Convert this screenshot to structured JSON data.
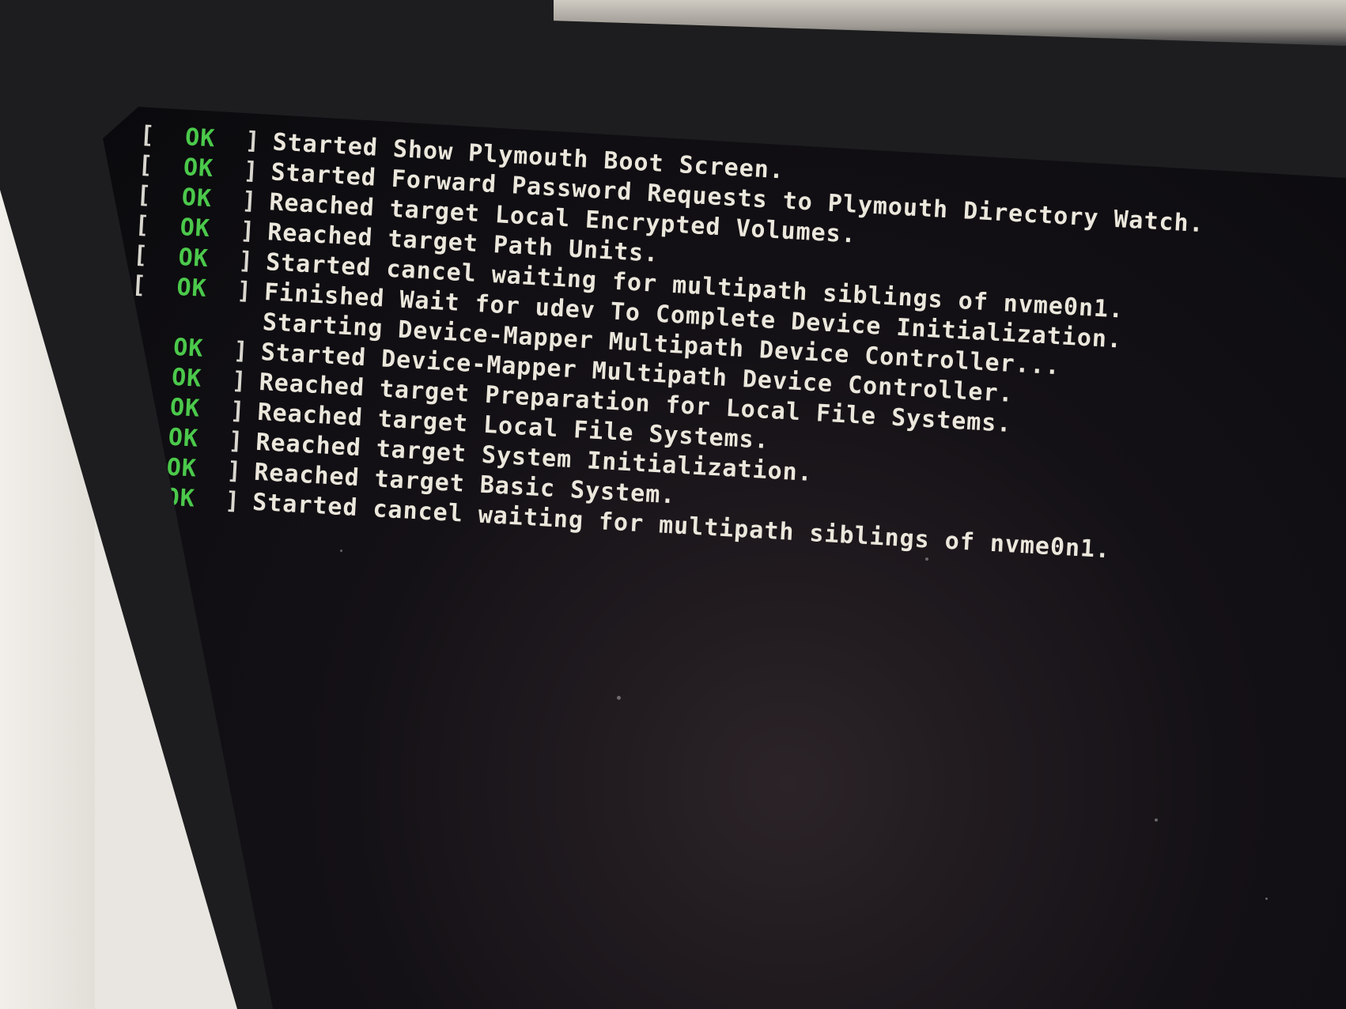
{
  "console": {
    "lines": [
      {
        "status": "OK",
        "message": "Started Show Plymouth Boot Screen."
      },
      {
        "status": "OK",
        "message": "Started Forward Password Requests to Plymouth Directory Watch."
      },
      {
        "status": "OK",
        "message": "Reached target Local Encrypted Volumes."
      },
      {
        "status": "OK",
        "message": "Reached target Path Units."
      },
      {
        "status": "OK",
        "message": "Started cancel waiting for multipath siblings of nvme0n1."
      },
      {
        "status": "OK",
        "message": "Finished Wait for udev To Complete Device Initialization."
      },
      {
        "status": "",
        "message": "Starting Device-Mapper Multipath Device Controller..."
      },
      {
        "status": "OK",
        "message": "Started Device-Mapper Multipath Device Controller."
      },
      {
        "status": "OK",
        "message": "Reached target Preparation for Local File Systems."
      },
      {
        "status": "OK",
        "message": "Reached target Local File Systems."
      },
      {
        "status": "OK",
        "message": "Reached target System Initialization."
      },
      {
        "status": "OK",
        "message": "Reached target Basic System."
      },
      {
        "status": "OK",
        "message": "Started cancel waiting for multipath siblings of nvme0n1."
      }
    ],
    "bracket_open": "[",
    "bracket_close": "]",
    "status_color": "#4bc94b",
    "text_color": "#ebe7dc",
    "background_color": "#0a0a0d"
  }
}
